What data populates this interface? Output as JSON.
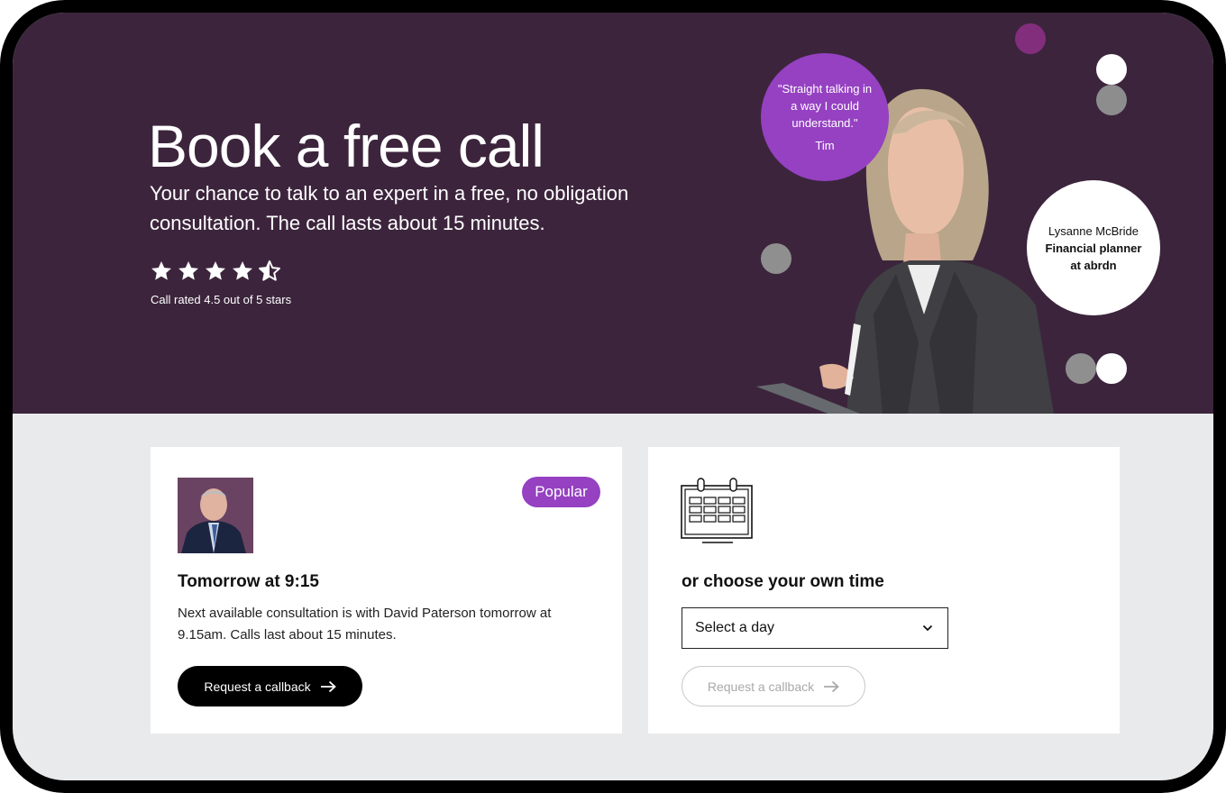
{
  "hero": {
    "title": "Book a free call",
    "subtitle": "Your chance to talk to an expert in a free, no obligation consultation. The call lasts about 15 minutes.",
    "rating": {
      "value": 4.5,
      "max": 5,
      "text": "Call rated 4.5 out of 5 stars"
    },
    "quote": {
      "text": "\"Straight talking in a way I could understand.\"",
      "author": "Tim"
    },
    "advisor": {
      "name": "Lysanne McBride",
      "role": "Financial planner at abrdn"
    }
  },
  "next_slot": {
    "badge": "Popular",
    "title": "Tomorrow at 9:15",
    "description": "Next available consultation is with David Paterson tomorrow at 9.15am. Calls last about 15 minutes.",
    "button": "Request a callback"
  },
  "own_time": {
    "title": "or choose your own time",
    "select_value": "Select a day",
    "button": "Request a callback"
  },
  "colors": {
    "hero_background": "#3c253c",
    "accent_purple": "#9541c2",
    "page_background": "#e9eaec"
  },
  "icons": [
    "star-icon",
    "half-star-icon",
    "calendar-icon",
    "chevron-down-icon",
    "arrow-right-icon"
  ]
}
